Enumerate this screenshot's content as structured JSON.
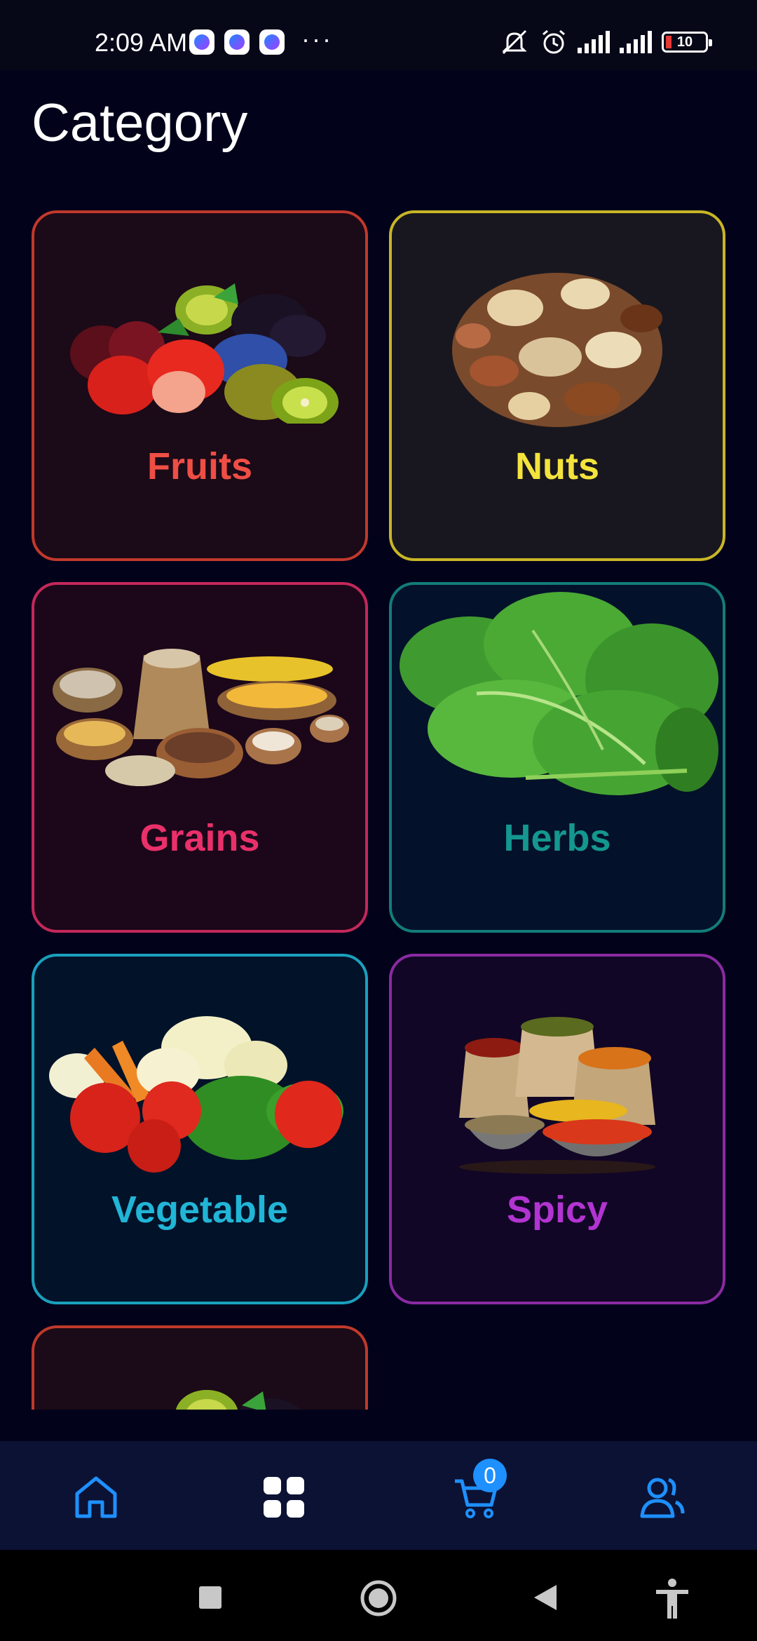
{
  "status_bar": {
    "time": "2:09 AM",
    "more": "···",
    "notification_icons": [
      "messenger-icon",
      "messenger-icon",
      "messenger-icon"
    ],
    "right_icons": [
      "muted-bell-icon",
      "alarm-icon",
      "signal-icon",
      "signal-icon",
      "battery-icon"
    ],
    "battery_level": "10"
  },
  "page": {
    "title": "Category"
  },
  "categories": [
    {
      "label": "Fruits",
      "color": "#ef4e45",
      "image": "fruits-image"
    },
    {
      "label": "Nuts",
      "color": "#f3e33c",
      "image": "nuts-image"
    },
    {
      "label": "Grains",
      "color": "#e9306a",
      "image": "grains-image"
    },
    {
      "label": "Herbs",
      "color": "#14978f",
      "image": "herbs-image"
    },
    {
      "label": "Vegetable",
      "color": "#21b5d6",
      "image": "vegetable-image"
    },
    {
      "label": "Spicy",
      "color": "#b234d1",
      "image": "spicy-image"
    }
  ],
  "bottom_nav": {
    "items": [
      "home-icon",
      "categories-icon",
      "cart-icon",
      "users-icon"
    ],
    "cart_count": "0",
    "accent": "#1e90ff"
  },
  "system_nav": [
    "recents-icon",
    "home-circle-icon",
    "back-icon",
    "accessibility-icon"
  ]
}
